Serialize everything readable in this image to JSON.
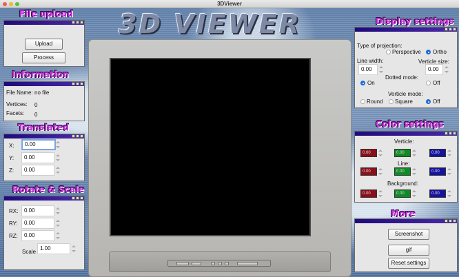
{
  "window": {
    "title": "3DViewer"
  },
  "logo": {
    "text": "3D VIEWER"
  },
  "file_upload": {
    "heading": "File upload",
    "upload_label": "Upload",
    "process_label": "Process"
  },
  "information": {
    "heading": "Information",
    "file_name_label": "File Name:",
    "file_name_value": "no file",
    "vertices_label": "Vertices:",
    "vertices_value": "0",
    "facets_label": "Facets:",
    "facets_value": "0"
  },
  "translated": {
    "heading": "Translated",
    "x_label": "X:",
    "x_value": "0.00",
    "y_label": "Y:",
    "y_value": "0.00",
    "z_label": "Z:",
    "z_value": "0.00"
  },
  "rotate_scale": {
    "heading": "Rotate & Scale",
    "rx_label": "RX:",
    "rx_value": "0.00",
    "ry_label": "RY:",
    "ry_value": "0.00",
    "rz_label": "RZ:",
    "rz_value": "0.00",
    "scale_label": "Scale",
    "scale_value": "1.00"
  },
  "display_settings": {
    "heading": "Display settings",
    "projection_label": "Type of projection:",
    "perspective_label": "Perspective",
    "ortho_label": "Ortho",
    "projection_selected": "Ortho",
    "line_width_label": "Line width:",
    "line_width_value": "0.00",
    "verticle_size_label": "Verticle size:",
    "verticle_size_value": "0.00",
    "dotted_mode_label": "Dotted mode:",
    "dotted_on_label": "On",
    "dotted_off_label": "Off",
    "dotted_selected": "On",
    "verticle_mode_label": "Verticle mode:",
    "round_label": "Round",
    "square_label": "Square",
    "verticle_off_label": "Off",
    "verticle_mode_selected": "Off"
  },
  "color_settings": {
    "heading": "Color settings",
    "verticle_label": "Verticle:",
    "line_label": "Line:",
    "background_label": "Background:",
    "verticle_values": [
      "0.00",
      "0.00",
      "0.00"
    ],
    "line_values": [
      "0.00",
      "0.00",
      "0.00"
    ],
    "background_values": [
      "0.00",
      "0.00",
      "0.00"
    ],
    "colors": {
      "red": "#8a0f1a",
      "green": "#0f8a25",
      "blue": "#1612a0"
    }
  },
  "more": {
    "heading": "More",
    "screenshot_label": "Screenshot",
    "gif_label": "gif",
    "reset_label": "Reset settings"
  }
}
